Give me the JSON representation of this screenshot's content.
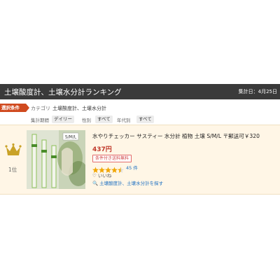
{
  "header": {
    "title": "土壌酸度計、土壌水分計ランキング",
    "aggregation": "集計日：4月25日"
  },
  "conditions": {
    "label": "選択条件",
    "category_label": "カテゴリ",
    "category_value": "土壌酸度計、土壌水分計",
    "filters": [
      {
        "label": "集計期間",
        "value": "デイリー"
      },
      {
        "label": "性別",
        "value": "すべて"
      },
      {
        "label": "年代別",
        "value": "すべて"
      }
    ]
  },
  "item": {
    "rank": "1位",
    "image_tag": "S/M/L",
    "title": "水やりチェッカー サスティー 水分計 植物 土壌 S/M/L 〒郵送可￥320",
    "price": "437円",
    "shipping_badge": "条件付き送料無料",
    "rating": 4.5,
    "review_count": "45 件",
    "like_label": "いいね",
    "link": "土壌酸度計、土壌水分計を探す",
    "colors": {
      "price": "#c0392b",
      "star": "#f0a500",
      "crown": "#c9a227"
    }
  }
}
